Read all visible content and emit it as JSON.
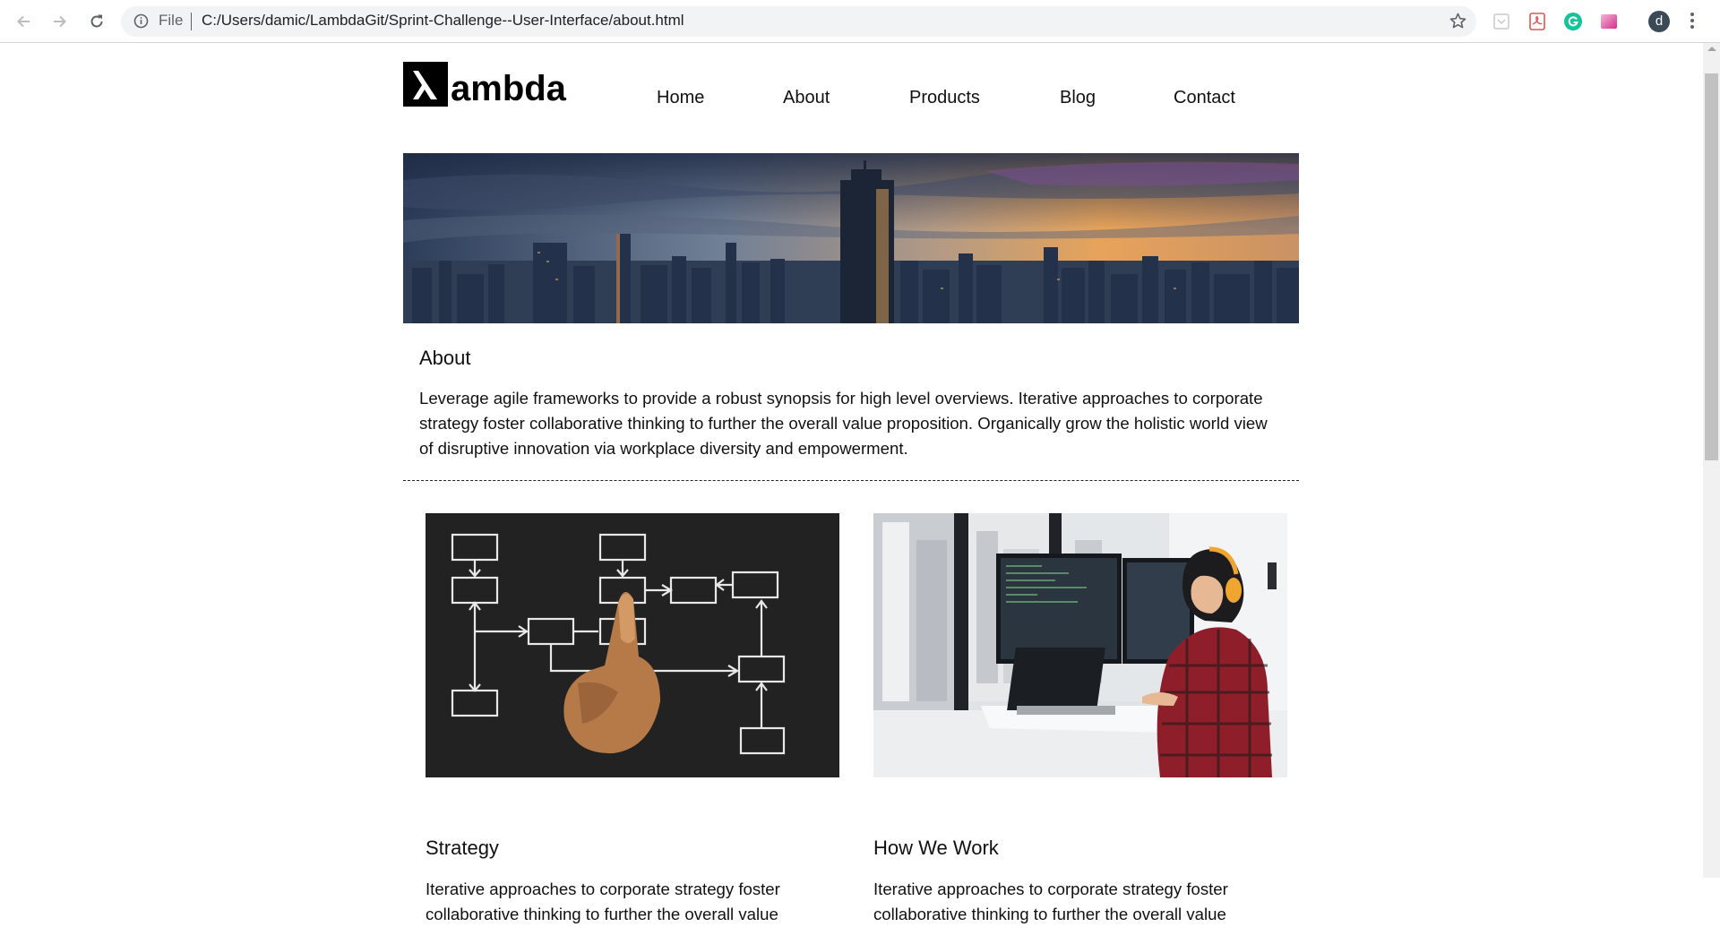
{
  "browser": {
    "protocol_label": "File",
    "url": "C:/Users/damic/LambdaGit/Sprint-Challenge--User-Interface/about.html",
    "profile_initial": "d",
    "toolbar_icons": [
      "back-icon",
      "forward-icon",
      "reload-icon",
      "info-icon",
      "star-icon",
      "pocket-icon",
      "pdf-icon",
      "grammarly-icon",
      "extension-gradient-icon",
      "avatar",
      "kebab-menu-icon"
    ]
  },
  "header": {
    "logo_text": "λambda",
    "nav": [
      "Home",
      "About",
      "Products",
      "Blog",
      "Contact"
    ]
  },
  "about": {
    "title": "About",
    "text": "Leverage agile frameworks to provide a robust synopsis for high level overviews. Iterative approaches to corporate strategy foster collaborative thinking to further the overall value proposition. Organically grow the holistic world view of disruptive innovation via workplace diversity and empowerment."
  },
  "cards": [
    {
      "title": "Strategy",
      "text": "Iterative approaches to corporate strategy foster collaborative thinking to further the overall value"
    },
    {
      "title": "How We Work",
      "text": "Iterative approaches to corporate strategy foster collaborative thinking to further the overall value"
    }
  ],
  "colors": {
    "page_background": "#ffffff",
    "text": "#111111",
    "omnibox": "#f1f3f4",
    "strategy_image_bg": "#222222"
  }
}
